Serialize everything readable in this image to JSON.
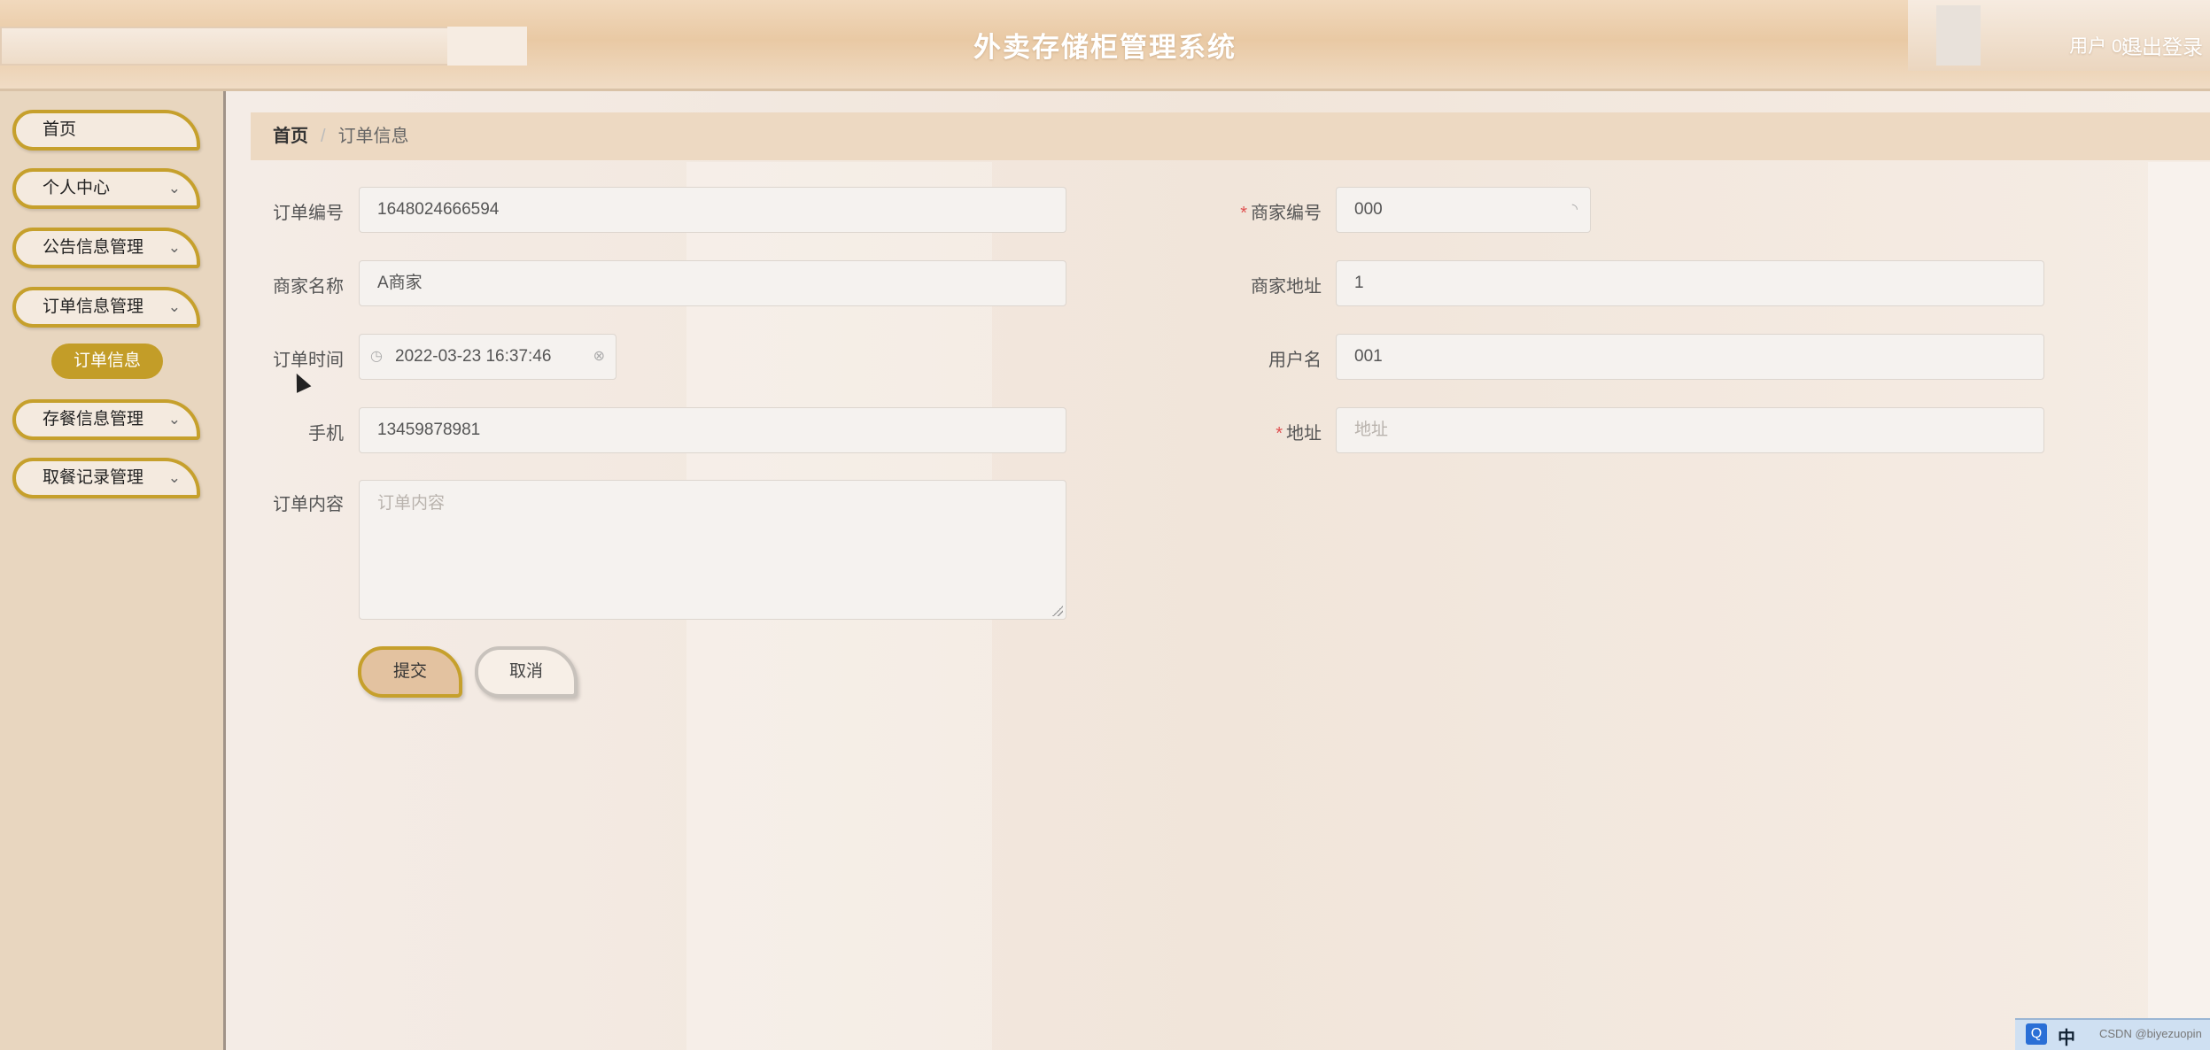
{
  "header": {
    "app_title": "外卖存储柜管理系统",
    "user_label": "用户 001",
    "logout_label": "退出登录"
  },
  "sidebar": {
    "items": [
      {
        "label": "首页",
        "expandable": false
      },
      {
        "label": "个人中心",
        "expandable": true
      },
      {
        "label": "公告信息管理",
        "expandable": true
      },
      {
        "label": "订单信息管理",
        "expandable": true
      },
      {
        "label": "存餐信息管理",
        "expandable": true
      },
      {
        "label": "取餐记录管理",
        "expandable": true
      }
    ],
    "active_subitem": "订单信息",
    "chevron": "chevron-down-icon"
  },
  "breadcrumb": {
    "home": "首页",
    "separator": "/",
    "current": "订单信息"
  },
  "form": {
    "order_no": {
      "label": "订单编号",
      "value": "1648024666594"
    },
    "merchant_no": {
      "label": "商家编号",
      "value": "000",
      "required": true
    },
    "merchant_name": {
      "label": "商家名称",
      "value": "A商家"
    },
    "merchant_address": {
      "label": "商家地址",
      "value": "1"
    },
    "order_time": {
      "label": "订单时间",
      "value": "2022-03-23 16:37:46"
    },
    "username": {
      "label": "用户名",
      "value": "001"
    },
    "phone": {
      "label": "手机",
      "value": "13459878981"
    },
    "address": {
      "label": "地址",
      "value": "",
      "placeholder": "地址",
      "required": true
    },
    "order_content": {
      "label": "订单内容",
      "value": "",
      "placeholder": "订单内容"
    },
    "submit_label": "提交",
    "cancel_label": "取消",
    "required_mark": "*"
  },
  "tray": {
    "ime": "中",
    "watermark": "CSDN @biyezuopin"
  }
}
